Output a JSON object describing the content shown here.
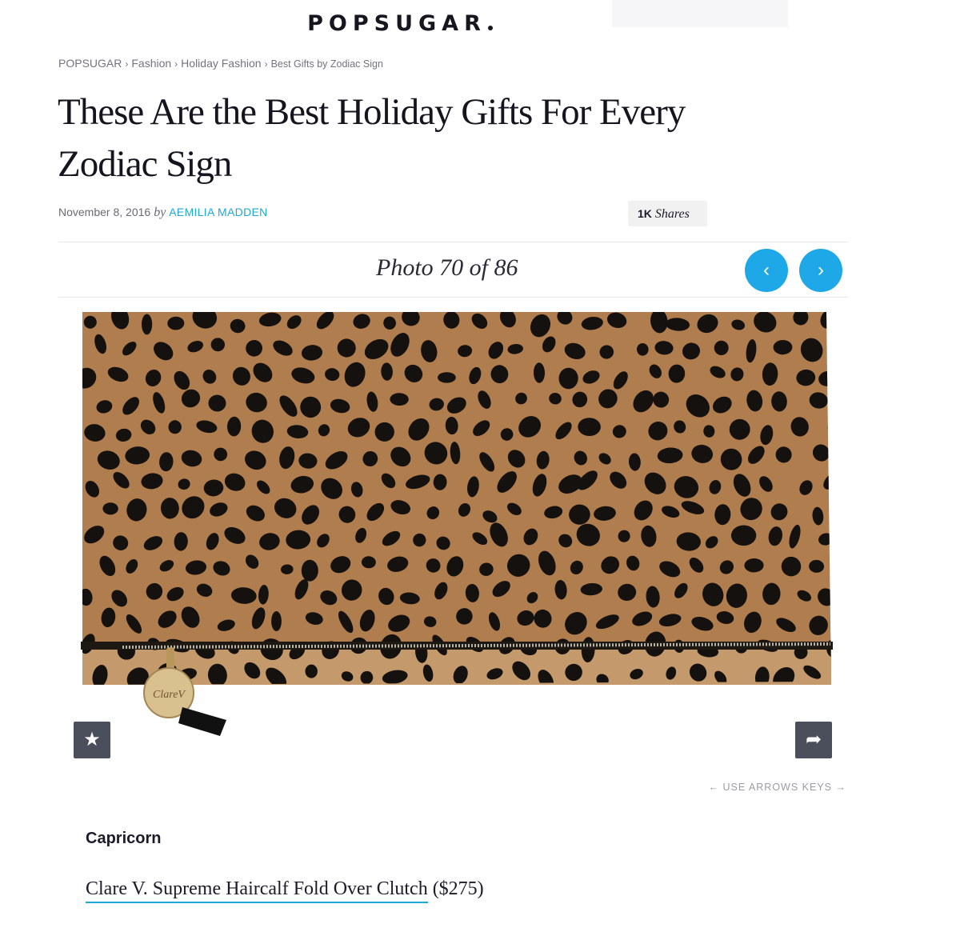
{
  "site": {
    "logo": "POPSUGAR"
  },
  "breadcrumb": [
    "POPSUGAR",
    "Fashion",
    "Holiday Fashion",
    "Best Gifts by Zodiac Sign"
  ],
  "breadcrumb_separator": "›",
  "article": {
    "title": "These Are the Best Holiday Gifts For Every Zodiac Sign",
    "date": "November 8, 2016",
    "by": "by",
    "author": "AEMILIA MADDEN",
    "shares_count": "1K",
    "shares_label": "Shares"
  },
  "gallery": {
    "counter": "Photo 70 of 86",
    "current": 70,
    "total": 86,
    "arrows_hint": "← USE ARROWS KEYS →",
    "brand_tag": "ClareV",
    "caption_sign": "Capricorn",
    "product_name": "Clare V. Supreme Haircalf Fold Over Clutch",
    "product_price": "($275)"
  },
  "colors": {
    "accent": "#1ea8e8",
    "link": "#1ea8d6",
    "fur": "#b07d4f",
    "spots": "#15110e",
    "button_dark": "#4b4e5b"
  },
  "icons": {
    "prev": "chevron-left-icon",
    "next": "chevron-right-icon",
    "favorite": "star-icon",
    "share": "share-arrow-icon"
  }
}
